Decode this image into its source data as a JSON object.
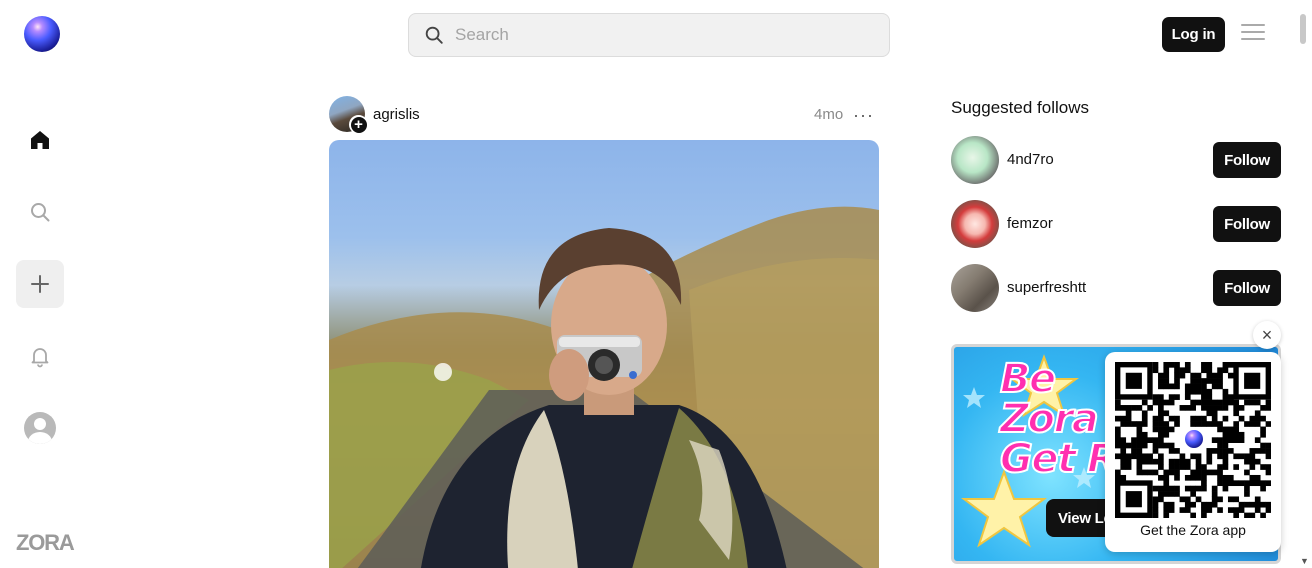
{
  "header": {
    "search": {
      "placeholder": "Search",
      "value": ""
    },
    "login_label": "Log in"
  },
  "nav": {
    "items": [
      {
        "name": "home",
        "icon": "home-icon",
        "active": true
      },
      {
        "name": "search",
        "icon": "search-icon",
        "active": false
      },
      {
        "name": "create",
        "icon": "plus-icon",
        "active": false
      },
      {
        "name": "notifications",
        "icon": "bell-icon",
        "active": false
      },
      {
        "name": "profile",
        "icon": "avatar",
        "active": false
      }
    ],
    "wordmark": "ZORA"
  },
  "post": {
    "username": "agrislis",
    "time": "4mo",
    "more_label": "···"
  },
  "suggested": {
    "title": "Suggested follows",
    "users": [
      {
        "name": "4nd7ro",
        "button": "Follow"
      },
      {
        "name": "femzor",
        "button": "Follow"
      },
      {
        "name": "superfreshtt",
        "button": "Follow"
      }
    ]
  },
  "promo": {
    "close_label": "×",
    "headline": "Be\nZora\nGet Re",
    "cta_label": "View Le",
    "qr_caption": "Get the Zora app"
  },
  "colors": {
    "primary": "#111111",
    "nav_muted": "#a8a8a8",
    "promo_pink": "#ff2fb0",
    "promo_blue": "#34b6f2"
  }
}
